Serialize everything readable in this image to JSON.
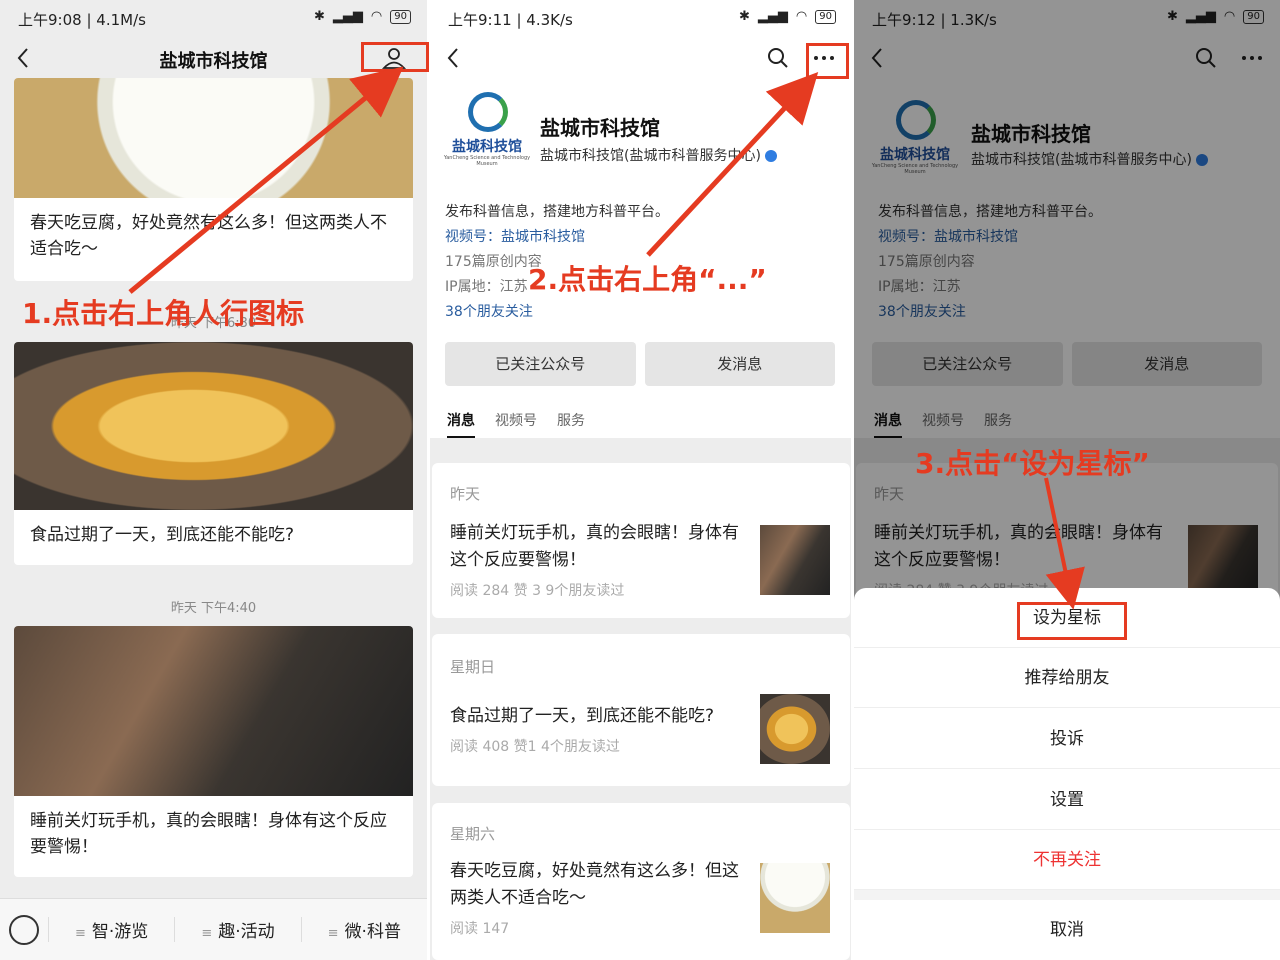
{
  "panel1": {
    "status": {
      "time": "上午9:08 | 4.1M/s",
      "battery": "90"
    },
    "title": "盐城市科技馆",
    "articles": [
      {
        "title": "春天吃豆腐，好处竟然有这么多！但这两类人不适合吃～"
      },
      {
        "title": "食品过期了一天，到底还能不能吃?"
      },
      {
        "title": "睡前关灯玩手机，真的会眼瞎！身体有这个反应要警惕！"
      }
    ],
    "timestamp1": "昨天 下午6:30",
    "timestamp2": "昨天 下午4:40",
    "menu": [
      "智·游览",
      "趣·活动",
      "微·科普"
    ],
    "annotation": "1.点击右上角人行图标"
  },
  "panel2": {
    "status": {
      "time": "上午9:11 | 4.3K/s",
      "battery": "90"
    },
    "logo_text": "盐城科技馆",
    "logo_sub": "YanCheng Science and Technology Museum",
    "name": "盐城市科技馆",
    "fullname": "盐城市科技馆(盐城市科普服务中心)",
    "desc": "发布科普信息，搭建地方科普平台。",
    "channel_label": "视频号：",
    "channel": "盐城市科技馆",
    "original": "175篇原创内容",
    "ip": "IP属地：江苏",
    "friends": "38个朋友关注",
    "buttons": [
      "已关注公众号",
      "发消息"
    ],
    "tabs": [
      "消息",
      "视频号",
      "服务"
    ],
    "messages": [
      {
        "date": "昨天",
        "title": "睡前关灯玩手机，真的会眼瞎！身体有这个反应要警惕！",
        "meta": "阅读 284  赞 3  9个朋友读过"
      },
      {
        "date": "星期日",
        "title": "食品过期了一天，到底还能不能吃?",
        "meta": "阅读 408  赞1  4个朋友读过"
      },
      {
        "date": "星期六",
        "title": "春天吃豆腐，好处竟然有这么多！但这两类人不适合吃～",
        "meta": "阅读 147"
      }
    ],
    "annotation": "2.点击右上角“...”"
  },
  "panel3": {
    "status": {
      "time": "上午9:12 | 1.3K/s",
      "battery": "90"
    },
    "sheet": [
      "设为星标",
      "推荐给朋友",
      "投诉",
      "设置",
      "不再关注"
    ],
    "cancel": "取消",
    "annotation": "3.点击“设为星标”",
    "visible_message_date": "昨天",
    "visible_message_title": "睡前关灯玩手机，真的会眼瞎！身体有这个反应要警惕！",
    "visible_message_meta": "阅读 284  赞 3  9个朋友读过"
  },
  "colors": {
    "annotation_red": "#e53b21",
    "link_blue": "#2a5d9f"
  }
}
